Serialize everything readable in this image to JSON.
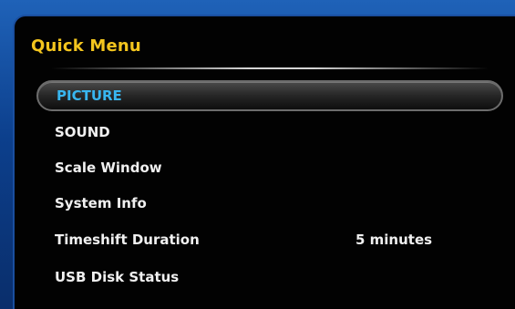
{
  "menu": {
    "title": "Quick Menu",
    "items": [
      {
        "label": "PICTURE",
        "value": "",
        "selected": true
      },
      {
        "label": "SOUND",
        "value": "",
        "selected": false
      },
      {
        "label": "Scale Window",
        "value": "",
        "selected": false
      },
      {
        "label": "System Info",
        "value": "",
        "selected": false
      },
      {
        "label": "Timeshift Duration",
        "value": "5 minutes",
        "selected": false
      },
      {
        "label": "USB Disk Status",
        "value": "",
        "selected": false
      }
    ]
  },
  "colors": {
    "title": "#f3c51e",
    "selected_text": "#38b6f0",
    "item_text": "#f0f0f0",
    "frame_blue": "#1f62b8",
    "panel_bg": "#020202"
  }
}
